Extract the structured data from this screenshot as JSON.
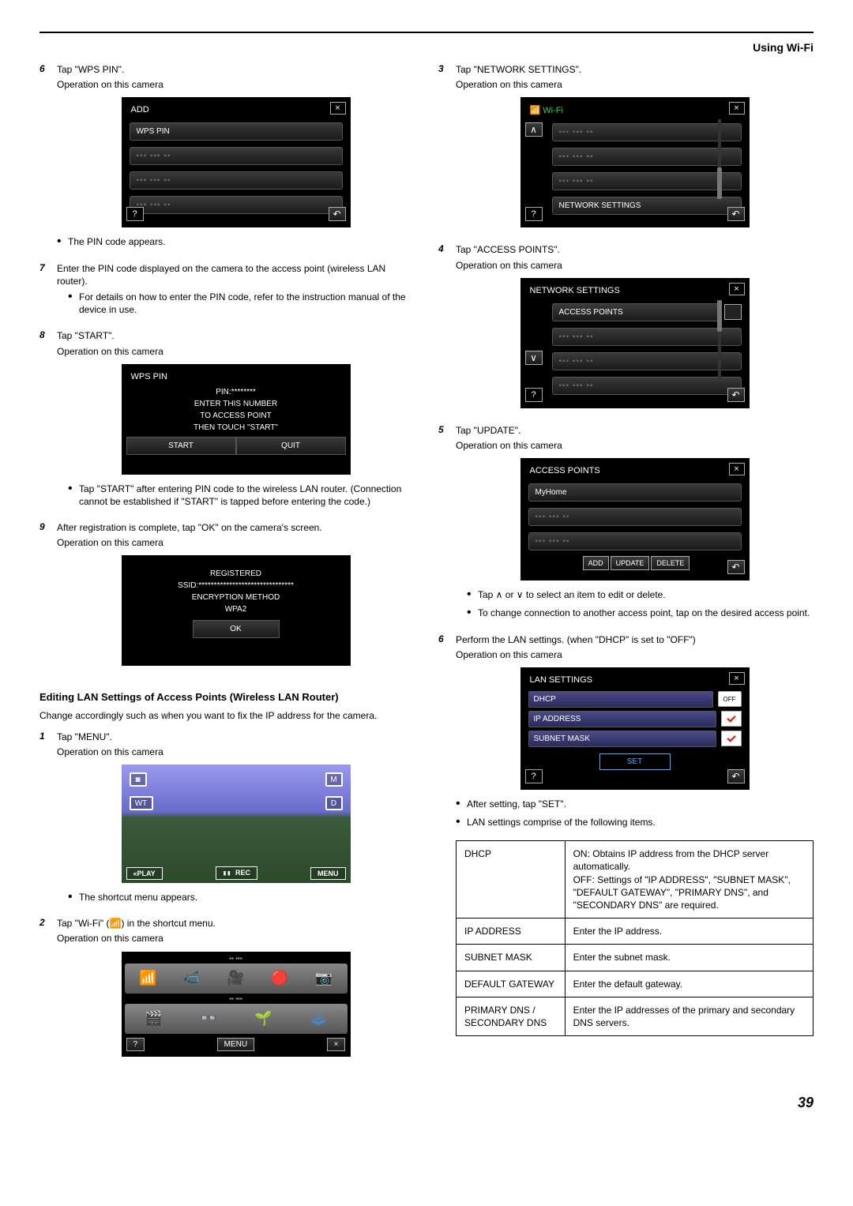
{
  "header": {
    "section": "Using Wi-Fi"
  },
  "left": {
    "step6": {
      "num": "6",
      "text": "Tap \"WPS PIN\".",
      "op": "Operation on this camera",
      "screen": {
        "title": "ADD",
        "item1": "WPS PIN"
      },
      "bullet": "The PIN code appears."
    },
    "step7": {
      "num": "7",
      "text": "Enter the PIN code displayed on the camera to the access point (wireless LAN router).",
      "bullet": "For details on how to enter the PIN code, refer to the instruction manual of the device in use."
    },
    "step8": {
      "num": "8",
      "text": "Tap \"START\".",
      "op": "Operation on this camera",
      "screen": {
        "title": "WPS PIN",
        "pin": "PIN:********",
        "l1": "ENTER THIS NUMBER",
        "l2": "TO ACCESS POINT",
        "l3": "THEN TOUCH \"START\"",
        "btn1": "START",
        "btn2": "QUIT"
      },
      "bullet": "Tap \"START\" after entering PIN code to the wireless LAN router. (Connection cannot be established if \"START\" is tapped before entering the code.)"
    },
    "step9": {
      "num": "9",
      "text": "After registration is complete, tap \"OK\" on the camera's screen.",
      "op": "Operation on this camera",
      "screen": {
        "l1": "REGISTERED",
        "l2": "SSID:*******************************",
        "l3": "ENCRYPTION METHOD",
        "l4": "WPA2",
        "ok": "OK"
      }
    },
    "section": "Editing LAN Settings of Access Points (Wireless LAN Router)",
    "intro": "Change accordingly such as when you want to fix the IP address for the camera.",
    "s1": {
      "num": "1",
      "text": "Tap \"MENU\".",
      "op": "Operation on this camera",
      "cam": {
        "wt": "WT",
        "m": "M",
        "d": "D",
        "play": "«PLAY",
        "rec": "REC",
        "menu": "MENU"
      },
      "bullet": "The shortcut menu appears."
    },
    "s2": {
      "num": "2",
      "text": "Tap \"Wi-Fi\" (  ) in the shortcut menu.",
      "op": "Operation on this camera",
      "screen": {
        "menu": "MENU"
      }
    }
  },
  "right": {
    "s3": {
      "num": "3",
      "text": "Tap \"NETWORK SETTINGS\".",
      "op": "Operation on this camera",
      "screen": {
        "title": "Wi-Fi",
        "item": "NETWORK SETTINGS"
      }
    },
    "s4": {
      "num": "4",
      "text": "Tap \"ACCESS POINTS\".",
      "op": "Operation on this camera",
      "screen": {
        "title": "NETWORK SETTINGS",
        "item": "ACCESS POINTS"
      }
    },
    "s5": {
      "num": "5",
      "text": "Tap \"UPDATE\".",
      "op": "Operation on this camera",
      "screen": {
        "title": "ACCESS POINTS",
        "item": "MyHome",
        "add": "ADD",
        "upd": "UPDATE",
        "del": "DELETE"
      },
      "bullet1": "Tap ∧ or ∨ to select an item to edit or delete.",
      "bullet2": "To change connection to another access point, tap on the desired access point."
    },
    "s6": {
      "num": "6",
      "text": "Perform the LAN settings. (when \"DHCP\" is set to \"OFF\")",
      "op": "Operation on this camera",
      "screen": {
        "title": "LAN SETTINGS",
        "dhcp": "DHCP",
        "off": "OFF",
        "ip": "IP ADDRESS",
        "mask": "SUBNET MASK",
        "set": "SET"
      },
      "bullet1": "After setting, tap \"SET\".",
      "bullet2": "LAN settings comprise of the following items."
    },
    "table": {
      "r1a": "DHCP",
      "r1b": "ON: Obtains IP address from the DHCP server automatically.\nOFF: Settings of \"IP ADDRESS\", \"SUBNET MASK\", \"DEFAULT GATEWAY\", \"PRIMARY DNS\", and \"SECONDARY DNS\" are required.",
      "r2a": "IP ADDRESS",
      "r2b": "Enter the IP address.",
      "r3a": "SUBNET MASK",
      "r3b": "Enter the subnet mask.",
      "r4a": "DEFAULT GATEWAY",
      "r4b": "Enter the default gateway.",
      "r5a": "PRIMARY DNS / SECONDARY DNS",
      "r5b": "Enter the IP addresses of the primary and secondary DNS servers."
    }
  },
  "page_number": "39"
}
